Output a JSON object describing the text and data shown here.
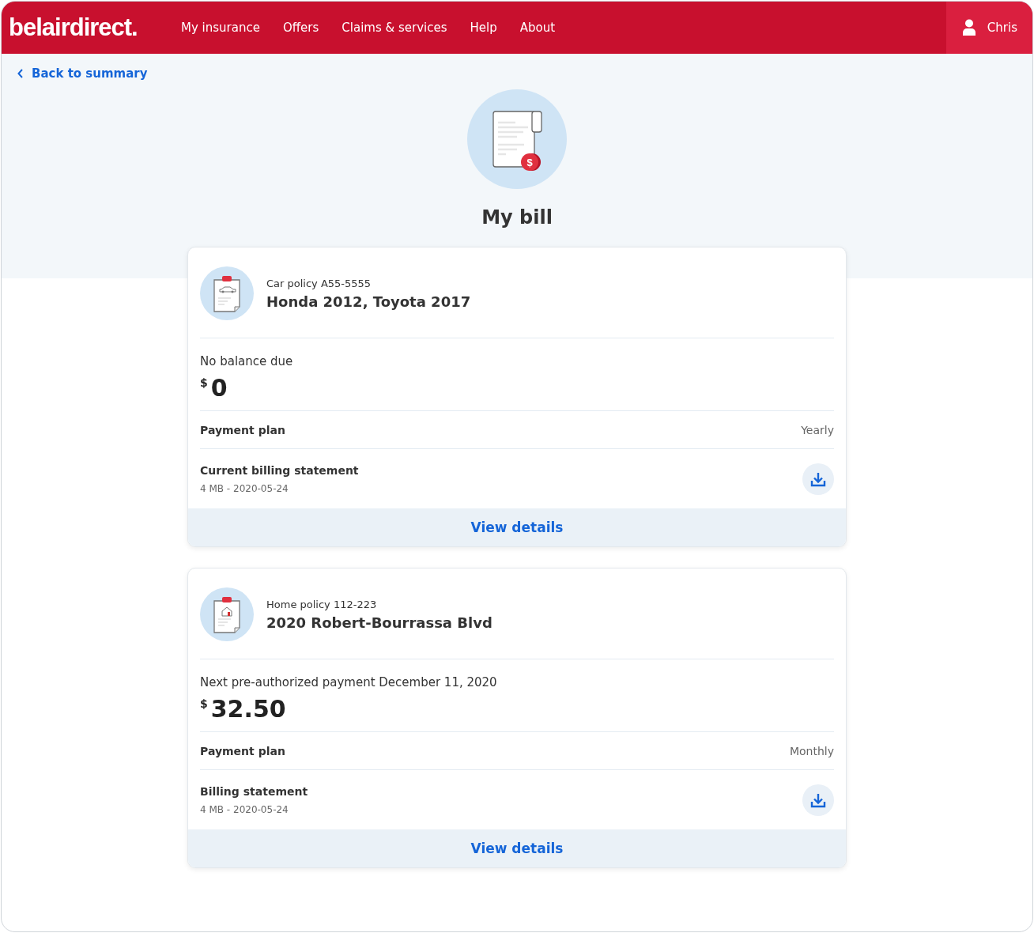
{
  "header": {
    "logo": "belairdirect.",
    "nav": [
      {
        "label": "My insurance"
      },
      {
        "label": "Offers"
      },
      {
        "label": "Claims & services"
      },
      {
        "label": "Help"
      },
      {
        "label": "About"
      }
    ],
    "user": "Chris"
  },
  "back_link": "Back to summary",
  "title": "My bill",
  "policies": [
    {
      "kind": "car",
      "policy": "Car policy A55-5555",
      "name": "Honda 2012, Toyota 2017",
      "status": "No balance due",
      "currency": "$",
      "amount": "0",
      "plan_label": "Payment plan",
      "plan": "Yearly",
      "statement_label": "Current billing statement",
      "statement_meta": "4 MB - 2020-05-24",
      "action": "View details"
    },
    {
      "kind": "home",
      "policy": "Home policy 112-223",
      "name": "2020 Robert-Bourrassa Blvd",
      "status": "Next pre-authorized payment December 11, 2020",
      "currency": "$",
      "amount": "32.50",
      "plan_label": "Payment plan",
      "plan": "Monthly",
      "statement_label": "Billing statement",
      "statement_meta": "4 MB - 2020-05-24",
      "action": "View details"
    }
  ]
}
